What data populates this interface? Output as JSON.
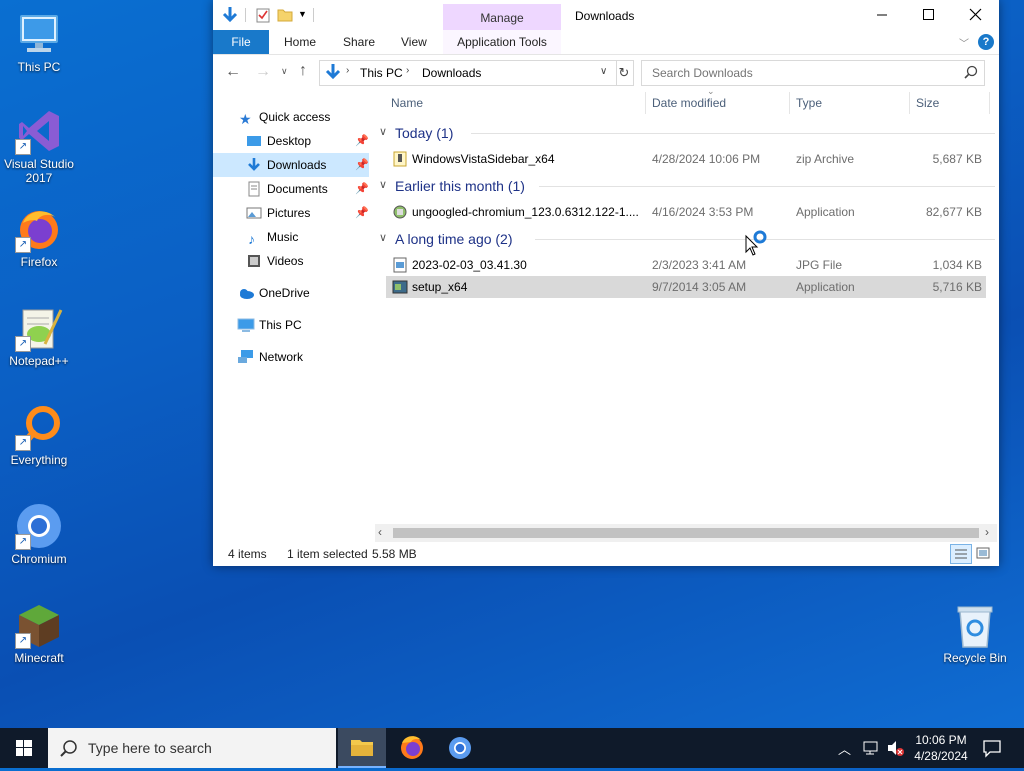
{
  "desktop": {
    "icons": [
      {
        "label": "This PC"
      },
      {
        "label": "Visual Studio 2017"
      },
      {
        "label": "Firefox"
      },
      {
        "label": "Notepad++"
      },
      {
        "label": "Everything"
      },
      {
        "label": "Chromium"
      },
      {
        "label": "Minecraft"
      },
      {
        "label": "Recycle Bin"
      }
    ]
  },
  "explorer": {
    "title": "Downloads",
    "context_tab": "Manage",
    "tabs": [
      "File",
      "Home",
      "Share",
      "View",
      "Application Tools"
    ],
    "address": {
      "crumbs": [
        "This PC",
        "Downloads"
      ]
    },
    "search": {
      "placeholder": "Search Downloads"
    },
    "columns": [
      "Name",
      "Date modified",
      "Type",
      "Size"
    ],
    "nav": {
      "quick_access": "Quick access",
      "items": [
        "Desktop",
        "Downloads",
        "Documents",
        "Pictures",
        "Music",
        "Videos"
      ],
      "onedrive": "OneDrive",
      "thispc": "This PC",
      "network": "Network"
    },
    "groups": [
      {
        "label": "Today (1)",
        "files": [
          {
            "name": "WindowsVistaSidebar_x64",
            "date": "4/28/2024 10:06 PM",
            "type": "zip Archive",
            "size": "5,687 KB"
          }
        ]
      },
      {
        "label": "Earlier this month (1)",
        "files": [
          {
            "name": "ungoogled-chromium_123.0.6312.122-1....",
            "date": "4/16/2024 3:53 PM",
            "type": "Application",
            "size": "82,677 KB"
          }
        ]
      },
      {
        "label": "A long time ago (2)",
        "files": [
          {
            "name": "2023-02-03_03.41.30",
            "date": "2/3/2023 3:41 AM",
            "type": "JPG File",
            "size": "1,034 KB"
          },
          {
            "name": "setup_x64",
            "date": "9/7/2014 3:05 AM",
            "type": "Application",
            "size": "5,716 KB"
          }
        ]
      }
    ],
    "status": {
      "items": "4 items",
      "selected": "1 item selected",
      "size": "5.58 MB"
    }
  },
  "taskbar": {
    "search_placeholder": "Type here to search",
    "time": "10:06 PM",
    "date": "4/28/2024"
  },
  "colors": {
    "accent": "#1979ca",
    "selection": "#cce8ff",
    "selected_row": "#d9d9d9"
  }
}
